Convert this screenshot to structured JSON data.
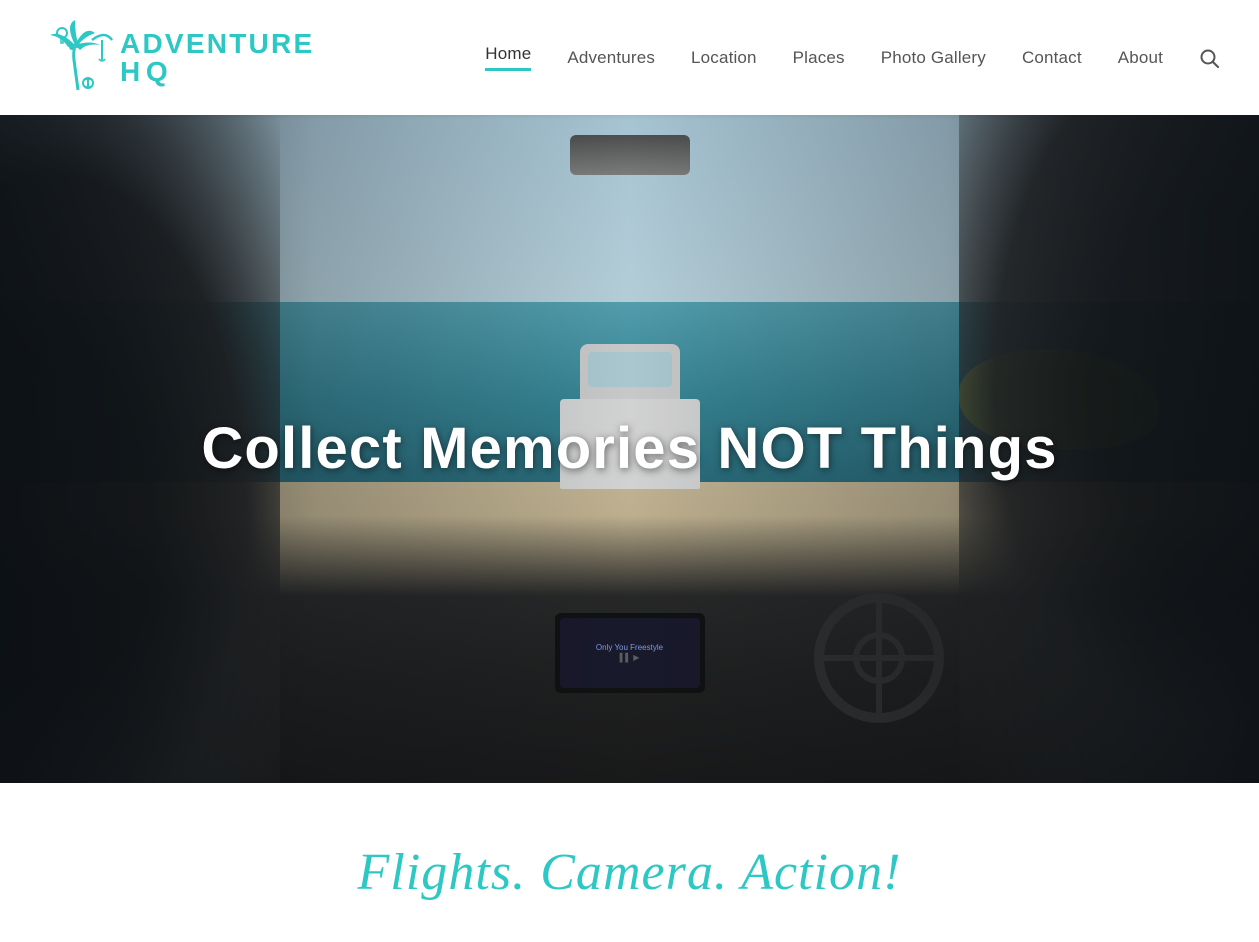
{
  "header": {
    "logo_alt": "Adventure HQ Logo",
    "nav": {
      "items": [
        {
          "label": "Home",
          "active": true,
          "id": "home"
        },
        {
          "label": "Adventures",
          "active": false,
          "id": "adventures"
        },
        {
          "label": "Location",
          "active": false,
          "id": "location"
        },
        {
          "label": "Places",
          "active": false,
          "id": "places"
        },
        {
          "label": "Photo Gallery",
          "active": false,
          "id": "photo-gallery"
        },
        {
          "label": "Contact",
          "active": false,
          "id": "contact"
        },
        {
          "label": "About",
          "active": false,
          "id": "about"
        }
      ]
    }
  },
  "hero": {
    "headline": "Collect Memories NOT Things"
  },
  "below_hero": {
    "tagline": "Flights. Camera. Action!"
  },
  "brand": {
    "accent_color": "#2ec8c4",
    "logo_line1": "ADVENTURE",
    "logo_line2": "HQ"
  }
}
